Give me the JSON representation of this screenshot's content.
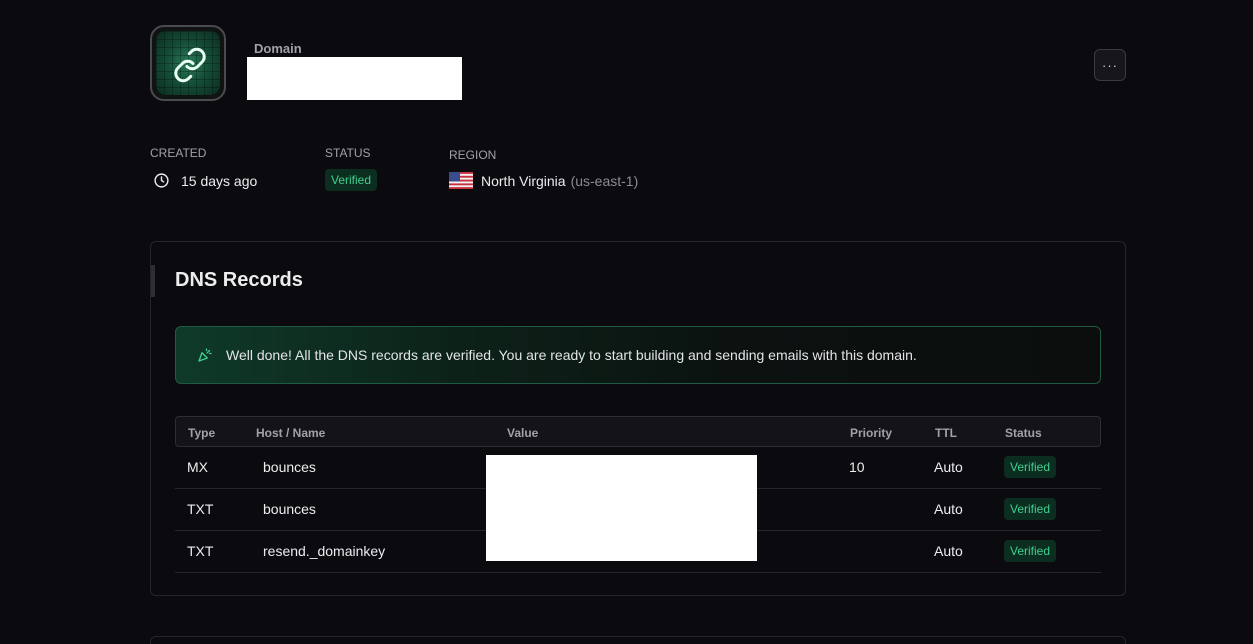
{
  "header": {
    "label": "Domain",
    "domain_name": "",
    "more_label": "···"
  },
  "meta": {
    "created_label": "CREATED",
    "created_value": "15 days ago",
    "status_label": "STATUS",
    "status_value": "Verified",
    "region_label": "REGION",
    "region_name": "North Virginia",
    "region_code": "(us-east-1)"
  },
  "dns": {
    "title": "DNS Records",
    "banner": "Well done! All the DNS records are verified. You are ready to start building and sending emails with this domain.",
    "columns": {
      "type": "Type",
      "host": "Host / Name",
      "value": "Value",
      "priority": "Priority",
      "ttl": "TTL",
      "status": "Status"
    },
    "rows": [
      {
        "type": "MX",
        "host": "bounces",
        "value": "",
        "priority": "10",
        "ttl": "Auto",
        "status": "Verified"
      },
      {
        "type": "TXT",
        "host": "bounces",
        "value": "",
        "priority": "",
        "ttl": "Auto",
        "status": "Verified"
      },
      {
        "type": "TXT",
        "host": "resend._domainkey",
        "value": "",
        "priority": "",
        "ttl": "Auto",
        "status": "Verified"
      }
    ]
  },
  "colors": {
    "accent_green": "#3fcf8e",
    "background": "#0b0a0f"
  },
  "icons": {
    "domain": "link-icon",
    "created": "clock-icon",
    "region": "us-flag-icon",
    "banner": "party-popper-icon"
  }
}
